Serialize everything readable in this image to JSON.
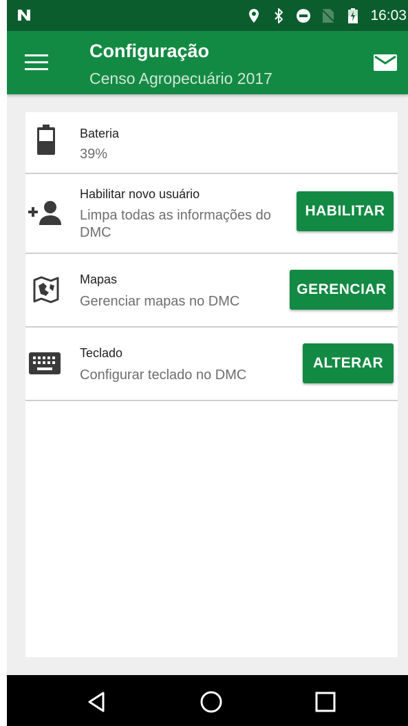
{
  "status_bar": {
    "time": "16:03",
    "icons": [
      "notification-n-icon",
      "location-icon",
      "bluetooth-icon",
      "do-not-disturb-icon",
      "no-sim-icon",
      "battery-charging-icon"
    ]
  },
  "app_bar": {
    "title": "Configuração",
    "subtitle": "Censo Agropecuário 2017",
    "icons": [
      "menu-icon",
      "mail-icon"
    ]
  },
  "settings": {
    "battery": {
      "title": "Bateria",
      "value": "39%",
      "level_percent": 39
    },
    "new_user": {
      "title": "Habilitar novo usuário",
      "subtitle": "Limpa todas as informações do DMC",
      "button": "HABILITAR"
    },
    "maps": {
      "title": "Mapas",
      "subtitle": "Gerenciar mapas no DMC",
      "button": "GERENCIAR"
    },
    "keyboard": {
      "title": "Teclado",
      "subtitle": "Configurar teclado no DMC",
      "button": "ALTERAR"
    }
  },
  "nav_bar": {
    "icons": [
      "back-icon",
      "home-icon",
      "recents-icon"
    ]
  },
  "colors": {
    "status_bar": "#0b5d2e",
    "app_bar": "#138a43",
    "button": "#138a43",
    "background": "#efefef"
  }
}
